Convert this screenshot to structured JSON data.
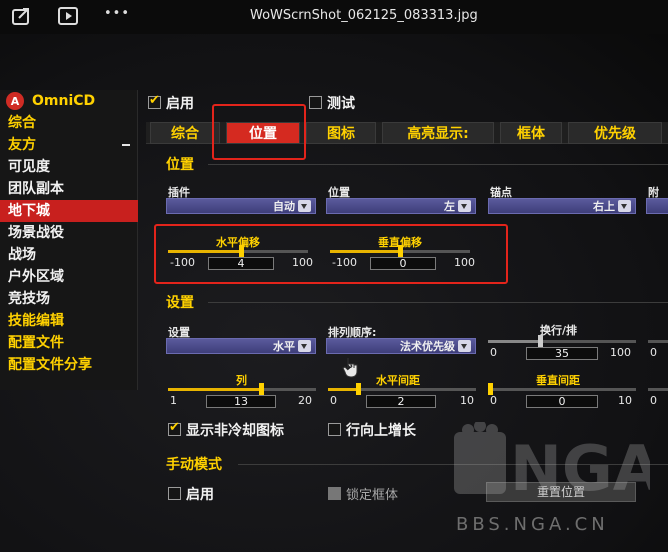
{
  "viewer": {
    "filename": "WoWScrnShot_062125_083313.jpg",
    "icons": [
      "share-icon",
      "play-icon",
      "more-icon"
    ],
    "more_glyph": "•••"
  },
  "sidebar": {
    "app_name": "OmniCD",
    "logo_glyph": "A",
    "items": [
      {
        "label": "综合",
        "color": "yellow"
      },
      {
        "label": "友方",
        "color": "yellow",
        "collapse": true
      },
      {
        "label": "可见度",
        "color": "white"
      },
      {
        "label": "团队副本",
        "color": "white"
      },
      {
        "label": "地下城",
        "color": "white",
        "active": true
      },
      {
        "label": "场景战役",
        "color": "white"
      },
      {
        "label": "战场",
        "color": "white"
      },
      {
        "label": "户外区域",
        "color": "white"
      },
      {
        "label": "竞技场",
        "color": "white"
      },
      {
        "label": "技能编辑",
        "color": "yellow"
      },
      {
        "label": "配置文件",
        "color": "yellow"
      },
      {
        "label": "配置文件分享",
        "color": "yellow"
      }
    ]
  },
  "panel": {
    "enable_label": "启用",
    "enable_checked": true,
    "test_label": "测试",
    "test_checked": false,
    "tabs": [
      {
        "label": "综合"
      },
      {
        "label": "位置",
        "active": true
      },
      {
        "label": "图标"
      },
      {
        "label": "高亮显示:"
      },
      {
        "label": "框体"
      },
      {
        "label": "优先级"
      }
    ],
    "position_section": {
      "title": "位置",
      "plugin_label": "插件",
      "plugin_value": "自动",
      "position_label": "位置",
      "position_value": "左",
      "anchor_label": "锚点",
      "anchor_value": "右上",
      "attach_label": "附着",
      "h_offset": {
        "label": "水平偏移",
        "min": "-100",
        "max": "100",
        "value": "4",
        "level": 0.52
      },
      "v_offset": {
        "label": "垂直偏移",
        "min": "-100",
        "max": "100",
        "value": "0",
        "level": 0.5
      }
    },
    "settings_section": {
      "title": "设置",
      "layout_label": "设置",
      "layout_value": "水平",
      "sort_label": "排列顺序:",
      "sort_value": "法术优先级",
      "wrap": {
        "label": "换行/排",
        "min": "0",
        "max": "100",
        "value": "35",
        "level": 0.35
      },
      "columns": {
        "label": "列",
        "min": "1",
        "max": "20",
        "value": "13",
        "level": 0.63
      },
      "h_spacing": {
        "label": "水平间距",
        "min": "0",
        "max": "10",
        "value": "2",
        "level": 0.2
      },
      "v_spacing": {
        "label": "垂直间距",
        "min": "0",
        "max": "10",
        "value": "0",
        "level": 0.0
      },
      "show_noncd_label": "显示非冷却图标",
      "show_noncd_checked": true,
      "grow_up_label": "行向上增长",
      "grow_up_checked": false
    },
    "manual_section": {
      "title": "手动模式",
      "enable_label": "启用",
      "enable_checked": false,
      "lock_label": "锁定框体",
      "reset_label": "重置位置"
    }
  },
  "watermark": {
    "logo_text": "NGA",
    "site": "BBS.NGA.CN"
  },
  "colors": {
    "accent_yellow": "#ffd100",
    "active_red": "#c8201e",
    "highlight_box": "#e3241b"
  }
}
